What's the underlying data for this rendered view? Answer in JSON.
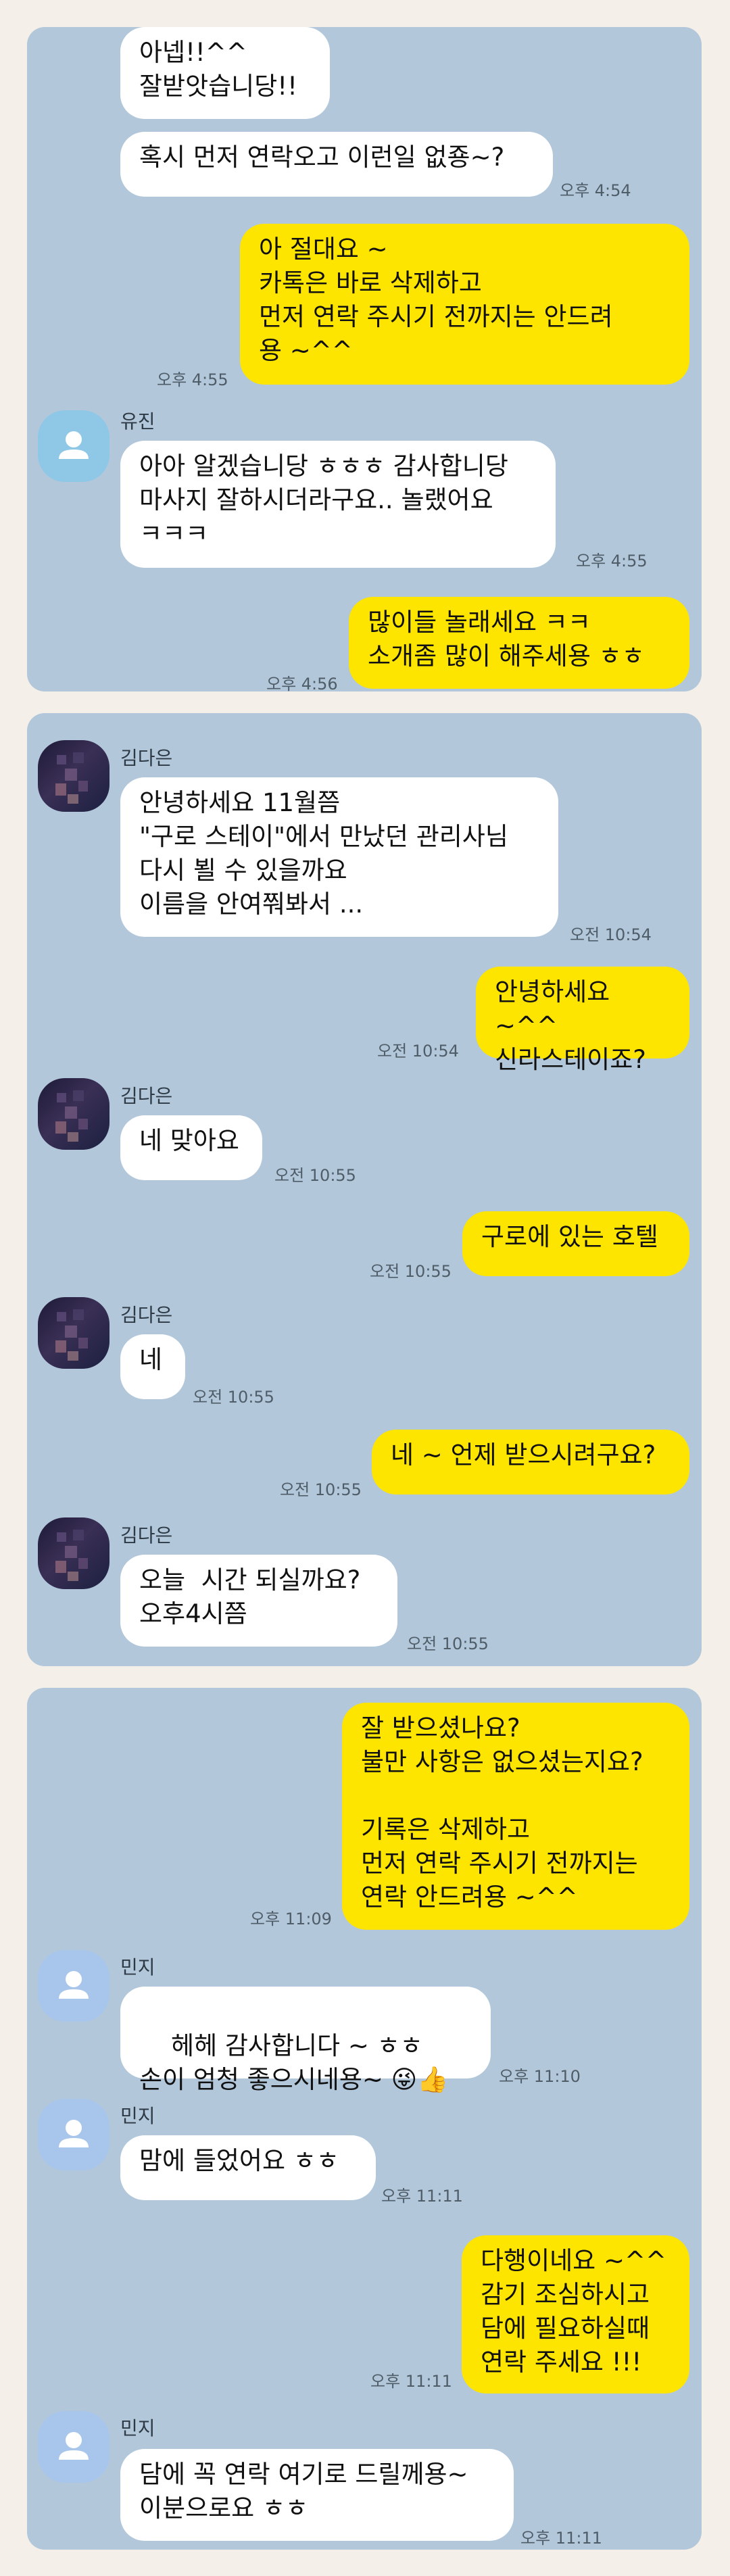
{
  "panel1": {
    "messages": [
      {
        "side": "in",
        "text": "아넵!!^^\n잘받앗습니당!!"
      },
      {
        "side": "in",
        "text": "혹시 먼저 연락오고 이런일 없죵~?",
        "time": "오후 4:54"
      },
      {
        "side": "out",
        "text": "아 절대요 ~\n카톡은 바로 삭제하고\n먼저 연락 주시기 전까지는 안드려\n용 ~^^",
        "time": "오후 4:55"
      },
      {
        "side": "in",
        "sender": "유진",
        "text": "아아 알겠습니당 ㅎㅎㅎ 감사합니당\n마사지 잘하시더라구요.. 놀랬어요\nㅋㅋㅋ",
        "time": "오후 4:55"
      },
      {
        "side": "out",
        "text": "많이들 놀래세요 ㅋㅋ\n소개좀 많이 해주세용 ㅎㅎ",
        "time": "오후 4:56"
      }
    ]
  },
  "panel2": {
    "messages": [
      {
        "side": "in",
        "sender": "김다은",
        "text": "안녕하세요 11월쯤\n\"구로 스테이\"에서 만났던 관리사님\n다시 뵐 수 있을까요\n이름을 안여쭤봐서 ...",
        "time": "오전 10:54"
      },
      {
        "side": "out",
        "text": "안녕하세요 ~^^\n신라스테이죠?",
        "time": "오전 10:54"
      },
      {
        "side": "in",
        "sender": "김다은",
        "text": "네 맞아요",
        "time": "오전 10:55"
      },
      {
        "side": "out",
        "text": "구로에 있는 호텔",
        "time": "오전 10:55"
      },
      {
        "side": "in",
        "sender": "김다은",
        "text": "네",
        "time": "오전 10:55"
      },
      {
        "side": "out",
        "text": "네 ~ 언제 받으시려구요?",
        "time": "오전 10:55"
      },
      {
        "side": "in",
        "sender": "김다은",
        "text": "오늘  시간 되실까요?\n오후4시쯤",
        "time": "오전 10:55"
      }
    ]
  },
  "panel3": {
    "messages": [
      {
        "side": "out",
        "text": "잘 받으셨나요?\n불만 사항은 없으셨는지요?\n\n기록은 삭제하고\n먼저 연락 주시기 전까지는\n연락 안드려용 ~^^",
        "time": "오후 11:09"
      },
      {
        "side": "in",
        "sender": "민지",
        "text": "헤헤 감사합니다 ~ ㅎㅎ\n손이 엄청 좋으시네용~ ",
        "emoji": "😜👍",
        "time": "오후 11:10"
      },
      {
        "side": "in",
        "sender": "민지",
        "text": "맘에 들었어요 ㅎㅎ",
        "time": "오후 11:11"
      },
      {
        "side": "out",
        "text": "다행이네요 ~^^\n감기 조심하시고\n담에 필요하실때\n연락 주세요 !!!",
        "time": "오후 11:11"
      },
      {
        "side": "in",
        "sender": "민지",
        "text": "담에 꼭 연락 여기로 드릴께용~\n이분으로요 ㅎㅎ",
        "time": "오후 11:11"
      }
    ]
  },
  "icons": {
    "default_avatar": "person-icon",
    "photo_avatar": "blurred-profile-photo"
  },
  "colors": {
    "background": "#b2c7da",
    "outgoing": "#fee500",
    "incoming": "#ffffff",
    "page": "#f4efe9"
  }
}
